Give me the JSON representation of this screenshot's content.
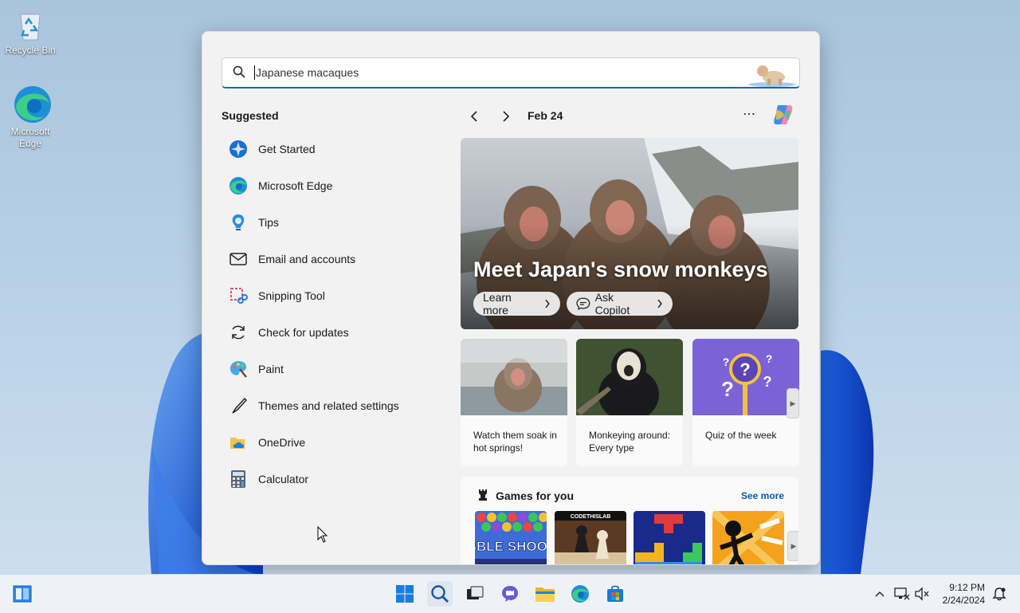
{
  "desktop": {
    "icons": [
      {
        "label": "Recycle Bin"
      },
      {
        "label": "Microsoft Edge"
      }
    ]
  },
  "search": {
    "value": "Japanese macaques"
  },
  "suggested": {
    "title": "Suggested",
    "items": [
      {
        "label": "Get Started",
        "icon": "get-started-icon"
      },
      {
        "label": "Microsoft Edge",
        "icon": "edge-icon"
      },
      {
        "label": "Tips",
        "icon": "tips-icon"
      },
      {
        "label": "Email and accounts",
        "icon": "mail-icon"
      },
      {
        "label": "Snipping Tool",
        "icon": "snipping-tool-icon"
      },
      {
        "label": "Check for updates",
        "icon": "update-icon"
      },
      {
        "label": "Paint",
        "icon": "paint-icon"
      },
      {
        "label": "Themes and related settings",
        "icon": "brush-icon"
      },
      {
        "label": "OneDrive",
        "icon": "onedrive-icon"
      },
      {
        "label": "Calculator",
        "icon": "calculator-icon"
      }
    ]
  },
  "highlights": {
    "date": "Feb 24",
    "hero": {
      "title": "Meet Japan's snow monkeys",
      "learn_more": "Learn more",
      "ask_copilot": "Ask Copilot"
    },
    "cards": [
      {
        "caption": "Watch them soak in hot springs!"
      },
      {
        "caption": "Monkeying around: Every type"
      },
      {
        "caption": "Quiz of the week"
      }
    ]
  },
  "games": {
    "title": "Games for you",
    "see_more": "See more",
    "tiles": [
      {
        "label": "BUBBLE SHOOTER"
      },
      {
        "label": "CODETHISLAB"
      },
      {
        "label": ""
      },
      {
        "label": ""
      }
    ]
  },
  "taskbar": {
    "time": "9:12 PM",
    "date": "2/24/2024"
  },
  "colors": {
    "accent": "#0067c0",
    "link": "#0a58a8"
  }
}
